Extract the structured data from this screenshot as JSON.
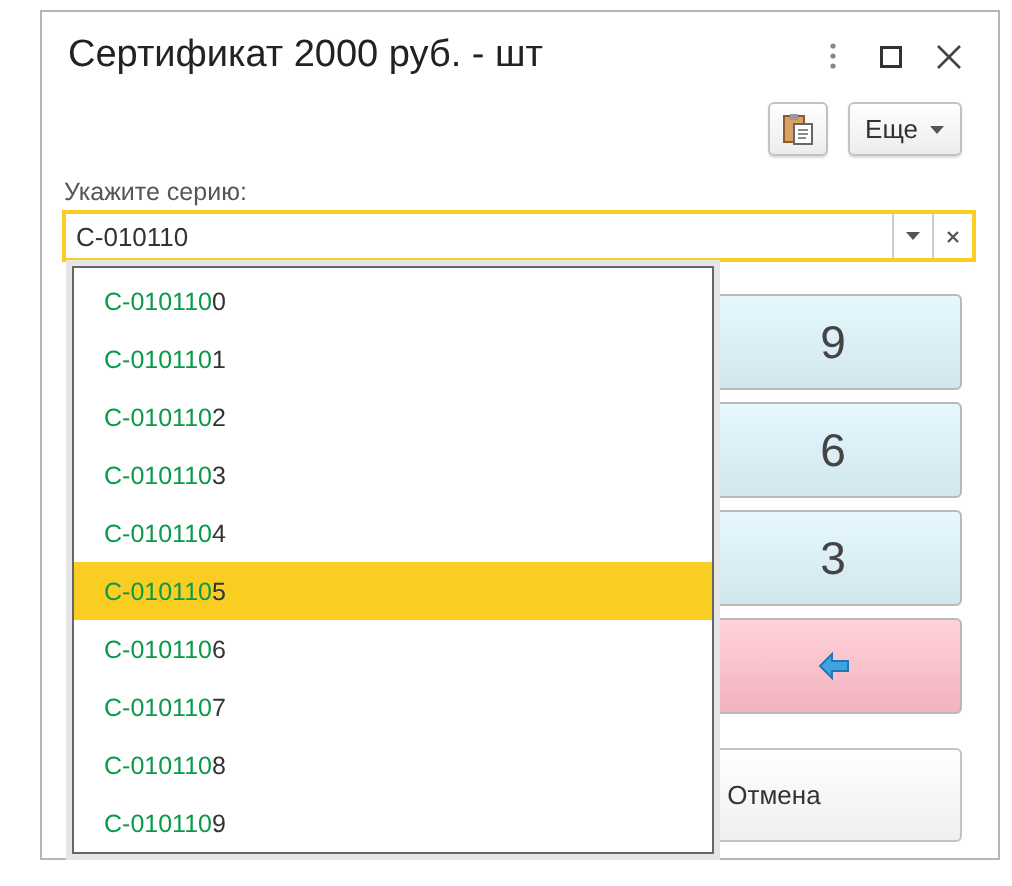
{
  "window": {
    "title": "Сертификат 2000 руб. - шт"
  },
  "toolbar": {
    "more_button": "Еще"
  },
  "series_field": {
    "label": "Укажите серию:",
    "value": "C-010110"
  },
  "dropdown": {
    "items": [
      {
        "match": "C-010110",
        "rest": "0",
        "selected": false
      },
      {
        "match": "C-010110",
        "rest": "1",
        "selected": false
      },
      {
        "match": "C-010110",
        "rest": "2",
        "selected": false
      },
      {
        "match": "C-010110",
        "rest": "3",
        "selected": false
      },
      {
        "match": "C-010110",
        "rest": "4",
        "selected": false
      },
      {
        "match": "C-010110",
        "rest": "5",
        "selected": true
      },
      {
        "match": "C-010110",
        "rest": "6",
        "selected": false
      },
      {
        "match": "C-010110",
        "rest": "7",
        "selected": false
      },
      {
        "match": "C-010110",
        "rest": "8",
        "selected": false
      },
      {
        "match": "C-010110",
        "rest": "9",
        "selected": false
      }
    ]
  },
  "keypad": [
    {
      "kind": "digit",
      "label": "9"
    },
    {
      "kind": "digit",
      "label": "6"
    },
    {
      "kind": "digit",
      "label": "3"
    },
    {
      "kind": "backspace"
    }
  ],
  "cancel_button": "Отмена"
}
